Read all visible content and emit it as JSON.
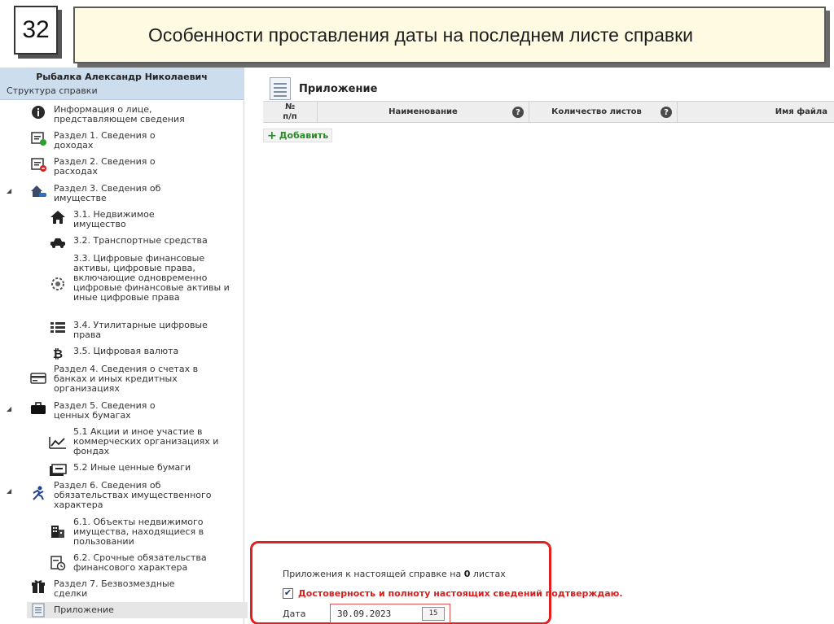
{
  "slide": {
    "number": "32",
    "title": "Особенности проставления даты на последнем листе справки"
  },
  "sidebar": {
    "user_name": "Рыбалка Александр Николаевич",
    "section_title": "Структура справки",
    "items": [
      {
        "label": "Информация о лице, представляющем сведения",
        "icon": "info-icon"
      },
      {
        "label": "Раздел 1. Сведения о доходах",
        "icon": "income-icon"
      },
      {
        "label": "Раздел 2. Сведения о расходах",
        "icon": "expenses-icon"
      },
      {
        "label": "Раздел 3. Сведения об имуществе",
        "icon": "property-icon"
      },
      {
        "label": "3.1. Недвижимое имущество",
        "icon": "house-icon"
      },
      {
        "label": "3.2. Транспортные средства",
        "icon": "car-icon"
      },
      {
        "label": "3.3. Цифровые финансовые активы, цифровые права, включающие одновременно цифровые финансовые активы и иные цифровые права",
        "icon": "digital-assets-icon"
      },
      {
        "label": "3.4. Утилитарные цифровые права",
        "icon": "list-icon"
      },
      {
        "label": "3.5. Цифровая валюта",
        "icon": "bitcoin-icon"
      },
      {
        "label": "Раздел 4. Сведения о счетах в банках и иных кредитных организациях",
        "icon": "card-icon"
      },
      {
        "label": "Раздел 5. Сведения о ценных бумагах",
        "icon": "briefcase-icon"
      },
      {
        "label": "5.1 Акции и иное участие в коммерческих организациях и фондах",
        "icon": "chart-icon"
      },
      {
        "label": "5.2 Иные ценные бумаги",
        "icon": "securities-icon"
      },
      {
        "label": "Раздел 6. Сведения об обязательствах имущественного характера",
        "icon": "obligations-icon"
      },
      {
        "label": "6.1. Объекты недвижимого имущества, находящиеся в пользовании",
        "icon": "building-icon"
      },
      {
        "label": "6.2. Срочные обязательства финансового характера",
        "icon": "document-clock-icon"
      },
      {
        "label": "Раздел 7. Безвозмездные сделки",
        "icon": "gift-icon"
      },
      {
        "label": "Приложение",
        "icon": "attachment-icon"
      }
    ]
  },
  "main": {
    "title": "Приложение",
    "columns": {
      "number": "№ п/п",
      "name": "Наименование",
      "sheets": "Количество листов",
      "file": "Имя файла"
    },
    "help_glyph": "?",
    "add_label": "Добавить",
    "footer": {
      "sheets_prefix": "Приложения к настоящей справке на",
      "sheets_count": "0",
      "sheets_suffix": "листах",
      "confirm_label": "Достоверность и полноту настоящих сведений подтверждаю.",
      "confirm_checked": true,
      "date_label": "Дата",
      "date_value": "30.09.2023",
      "calendar_day": "15"
    }
  },
  "colors": {
    "highlight_frame": "#e22020",
    "title_bg": "#fffbe3",
    "sidebar_header": "#ccddee",
    "add_green": "#2a8a2a",
    "confirm_red": "#d52020"
  }
}
